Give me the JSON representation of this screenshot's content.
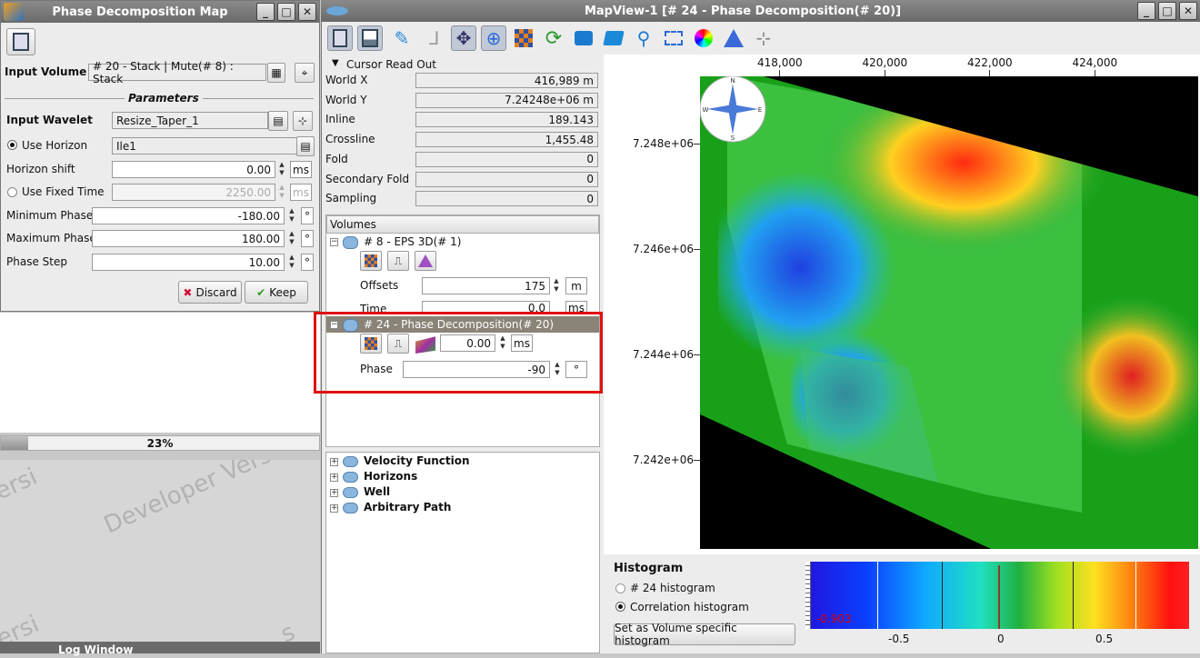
{
  "left_window": {
    "title": "Phase Decomposition Map",
    "input_volume_label": "Input Volume",
    "input_volume_value": "# 20 - Stack | Mute(# 8) : Stack",
    "parameters_header": "Parameters",
    "input_wavelet_label": "Input Wavelet",
    "input_wavelet_value": "Resize_Taper_1",
    "use_horizon_label": "Use Horizon",
    "use_horizon_value": "Ile1",
    "horizon_shift_label": "Horizon shift",
    "horizon_shift_value": "0.00",
    "horizon_shift_unit": "ms",
    "use_fixed_time_label": "Use Fixed Time",
    "use_fixed_time_value": "2250.00",
    "use_fixed_time_unit": "ms",
    "min_phase_label": "Minimum Phase",
    "min_phase_value": "-180.00",
    "max_phase_label": "Maximum Phase",
    "max_phase_value": "180.00",
    "phase_step_label": "Phase Step",
    "phase_step_value": "10.00",
    "degree_unit": "°",
    "discard_label": "Discard",
    "keep_label": "Keep"
  },
  "progress": {
    "text": "23%",
    "value": 0.23
  },
  "watermark": {
    "text": "Developer Version",
    "fragment_top": "ersi",
    "fragment_bottom": "ersi",
    "fragment_bottom2": "s"
  },
  "log_window": {
    "title": "Log Window"
  },
  "main_window": {
    "title": "MapView-1 [# 24 - Phase Decomposition(# 20)]"
  },
  "cursor_readout": {
    "header": "Cursor Read Out",
    "rows": [
      {
        "label": "World X",
        "value": "416,989 m"
      },
      {
        "label": "World Y",
        "value": "7.24248e+06 m"
      },
      {
        "label": "Inline",
        "value": "189.143"
      },
      {
        "label": "Crossline",
        "value": "1,455.48"
      },
      {
        "label": "Fold",
        "value": "0"
      },
      {
        "label": "Secondary Fold",
        "value": "0"
      },
      {
        "label": "Sampling",
        "value": "0"
      }
    ]
  },
  "volumes": {
    "header": "Volumes",
    "vol1": "# 8 - EPS 3D(# 1)",
    "offsets_label": "Offsets",
    "offsets_value": "175",
    "offsets_unit": "m",
    "time_label": "Time",
    "time_value": "0.0",
    "time_unit": "ms",
    "vol2": "# 24 - Phase Decomposition(# 20)",
    "shift_value": "0.00",
    "shift_unit": "ms",
    "phase_label": "Phase",
    "phase_value": "-90",
    "phase_unit": "°"
  },
  "tree": [
    "Velocity Function",
    "Horizons",
    "Well",
    "Arbitrary Path"
  ],
  "map": {
    "x_ticks": [
      "418,000",
      "420,000",
      "422,000",
      "424,000"
    ],
    "y_ticks": [
      "7.248e+06",
      "7.246e+06",
      "7.244e+06",
      "7.242e+06"
    ],
    "compass": [
      "N",
      "E",
      "S",
      "W"
    ]
  },
  "histogram": {
    "title": "Histogram",
    "option1": "# 24 histogram",
    "option2": "Correlation histogram",
    "selected": "Correlation histogram",
    "button": "Set as Volume specific histogram",
    "min_label": "-0.903",
    "ticks": [
      "-0.5",
      "0",
      "0.5"
    ]
  }
}
